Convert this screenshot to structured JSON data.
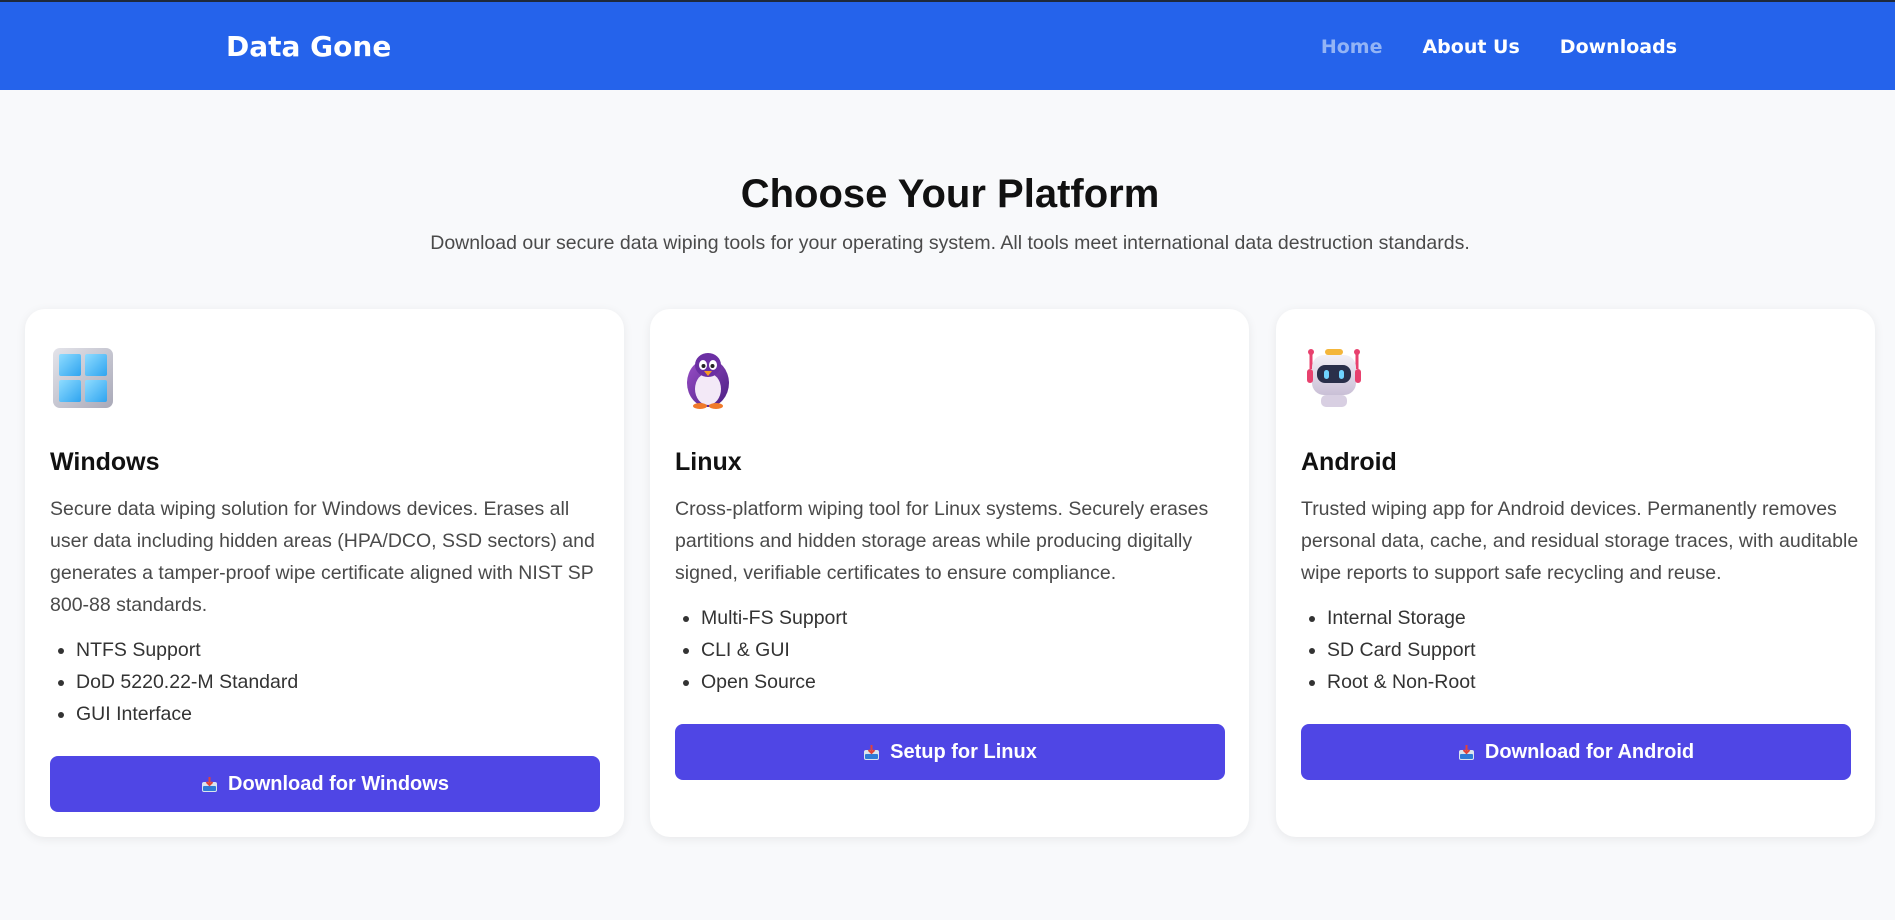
{
  "header": {
    "brand": "Data Gone",
    "nav": [
      {
        "label": "Home",
        "active": true
      },
      {
        "label": "About Us",
        "active": false
      },
      {
        "label": "Downloads",
        "active": false
      }
    ]
  },
  "hero": {
    "title": "Choose Your Platform",
    "subtitle": "Download our secure data wiping tools for your operating system. All tools meet international data destruction standards."
  },
  "cards": [
    {
      "icon": "windows-icon",
      "title": "Windows",
      "description": "Secure data wiping solution for Windows devices. Erases all user data including hidden areas (HPA/DCO, SSD sectors) and generates a tamper-proof wipe certificate aligned with NIST SP 800-88 standards.",
      "features": [
        "NTFS Support",
        "DoD 5220.22-M Standard",
        "GUI Interface"
      ],
      "button": "Download for Windows"
    },
    {
      "icon": "penguin-icon",
      "title": "Linux",
      "description": "Cross-platform wiping tool for Linux systems. Securely erases partitions and hidden storage areas while producing digitally signed, verifiable certificates to ensure compliance.",
      "features": [
        "Multi-FS Support",
        "CLI & GUI",
        "Open Source"
      ],
      "button": "Setup for Linux"
    },
    {
      "icon": "robot-icon",
      "title": "Android",
      "description": "Trusted wiping app for Android devices. Permanently removes personal data, cache, and residual storage traces, with auditable wipe reports to support safe recycling and reuse.",
      "features": [
        "Internal Storage",
        "SD Card Support",
        "Root & Non-Root"
      ],
      "button": "Download for Android"
    }
  ],
  "colors": {
    "navbar": "#2563eb",
    "button": "#4f46e5",
    "background": "#f8f9fb"
  }
}
